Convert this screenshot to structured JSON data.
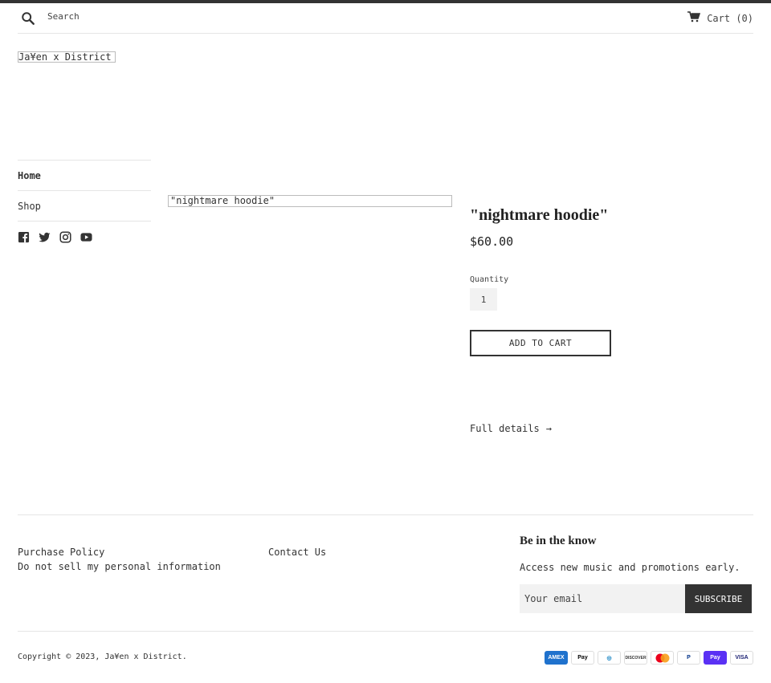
{
  "header": {
    "search_label": "Search",
    "cart_label": "Cart (0)"
  },
  "logo": {
    "text": "Ja¥en x District"
  },
  "nav": {
    "items": [
      {
        "label": "Home"
      },
      {
        "label": "Shop"
      }
    ]
  },
  "social": [
    "facebook-icon",
    "twitter-icon",
    "instagram-icon",
    "youtube-icon"
  ],
  "product": {
    "image_alt": "\"nightmare hoodie\"",
    "title": "\"nightmare hoodie\"",
    "price": "$60.00",
    "quantity_label": "Quantity",
    "quantity_value": "1",
    "add_to_cart_label": "ADD TO CART",
    "full_details_label": "Full details",
    "full_details_arrow": "→"
  },
  "footer": {
    "links_col1": [
      "Purchase Policy",
      "Do not sell my personal information"
    ],
    "links_col2": [
      "Contact Us"
    ],
    "newsletter_title": "Be in the know",
    "newsletter_text": "Access new music and promotions early.",
    "email_placeholder": "Your email",
    "subscribe_label": "SUBSCRIBE",
    "copyright": "Copyright © 2023, Ja¥en x District.",
    "payments": [
      {
        "name": "amex-icon",
        "label": "AMEX",
        "bg": "#1f72cd",
        "fg": "#ffffff"
      },
      {
        "name": "apple-pay-icon",
        "label": "Pay",
        "bg": "#ffffff",
        "fg": "#000000"
      },
      {
        "name": "diners-club-icon",
        "label": "◎",
        "bg": "#ffffff",
        "fg": "#0079be"
      },
      {
        "name": "discover-icon",
        "label": "DISCOVER",
        "bg": "#ffffff",
        "fg": "#333333"
      },
      {
        "name": "mastercard-icon",
        "label": "",
        "bg": "#ffffff",
        "fg": "#eb001b"
      },
      {
        "name": "paypal-icon",
        "label": "P",
        "bg": "#ffffff",
        "fg": "#003087"
      },
      {
        "name": "shop-pay-icon",
        "label": "Pay",
        "bg": "#5a31f4",
        "fg": "#ffffff"
      },
      {
        "name": "visa-icon",
        "label": "VISA",
        "bg": "#ffffff",
        "fg": "#1a1f71"
      }
    ]
  }
}
